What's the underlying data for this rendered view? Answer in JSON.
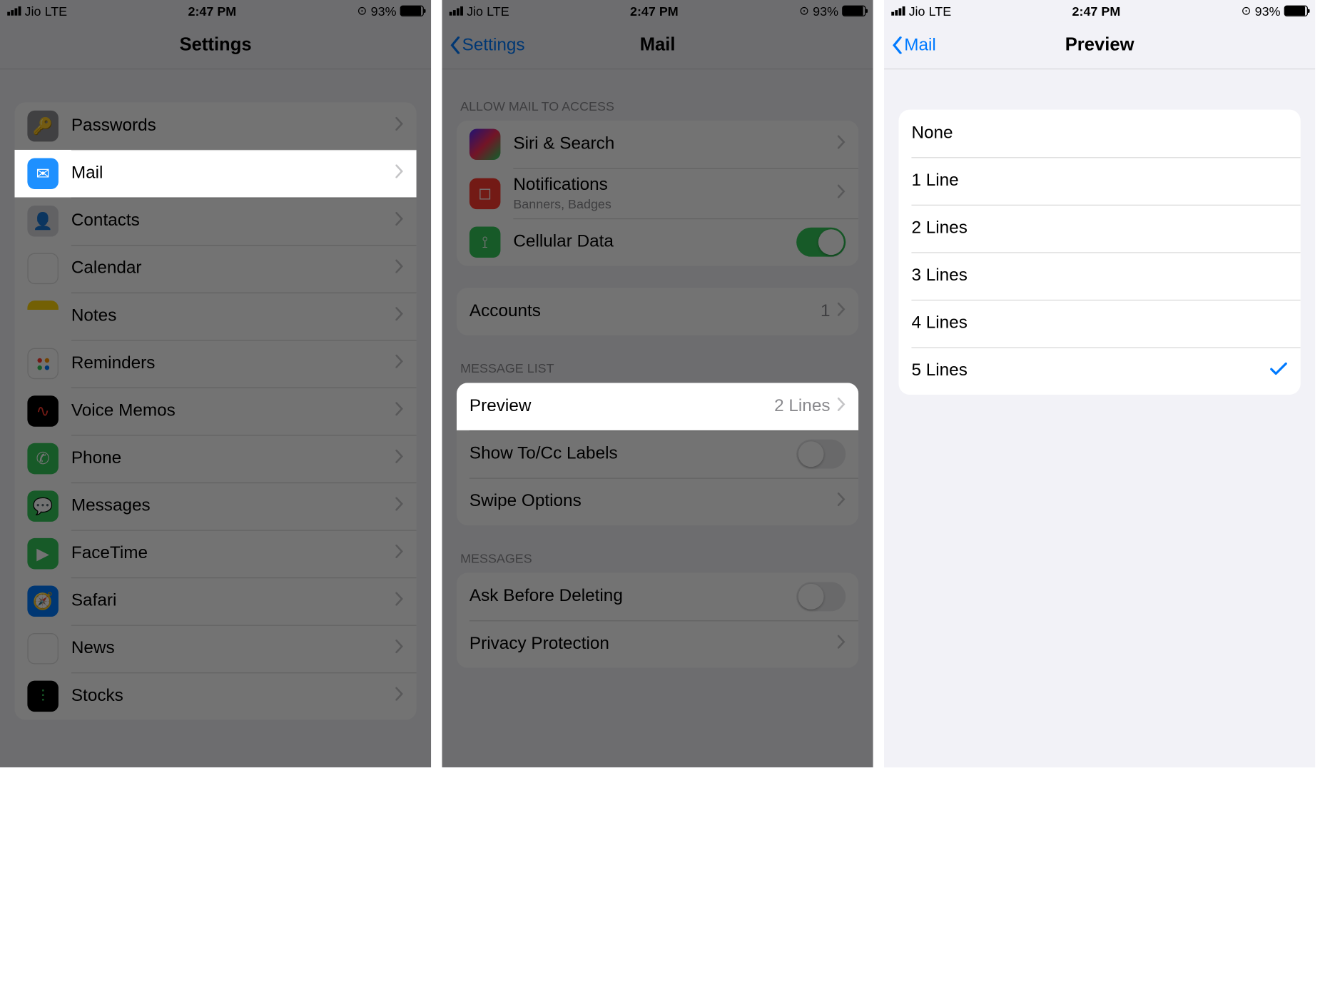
{
  "status": {
    "carrier": "Jio",
    "network": "LTE",
    "time": "2:47 PM",
    "battery_pct": "93%"
  },
  "screen1": {
    "title": "Settings",
    "rows": {
      "passwords": "Passwords",
      "mail": "Mail",
      "contacts": "Contacts",
      "calendar": "Calendar",
      "notes": "Notes",
      "reminders": "Reminders",
      "voice_memos": "Voice Memos",
      "phone": "Phone",
      "messages": "Messages",
      "facetime": "FaceTime",
      "safari": "Safari",
      "news": "News",
      "stocks": "Stocks"
    }
  },
  "screen2": {
    "back": "Settings",
    "title": "Mail",
    "sec_allow": "ALLOW MAIL TO ACCESS",
    "siri": "Siri & Search",
    "notifications": "Notifications",
    "notifications_sub": "Banners, Badges",
    "cellular": "Cellular Data",
    "accounts": "Accounts",
    "accounts_count": "1",
    "sec_message_list": "MESSAGE LIST",
    "preview": "Preview",
    "preview_value": "2 Lines",
    "show_tocc": "Show To/Cc Labels",
    "swipe": "Swipe Options",
    "sec_messages": "MESSAGES",
    "ask_delete": "Ask Before Deleting",
    "privacy": "Privacy Protection"
  },
  "screen3": {
    "back": "Mail",
    "title": "Preview",
    "options": {
      "none": "None",
      "one": "1 Line",
      "two": "2 Lines",
      "three": "3 Lines",
      "four": "4 Lines",
      "five": "5 Lines"
    },
    "selected": "five"
  }
}
